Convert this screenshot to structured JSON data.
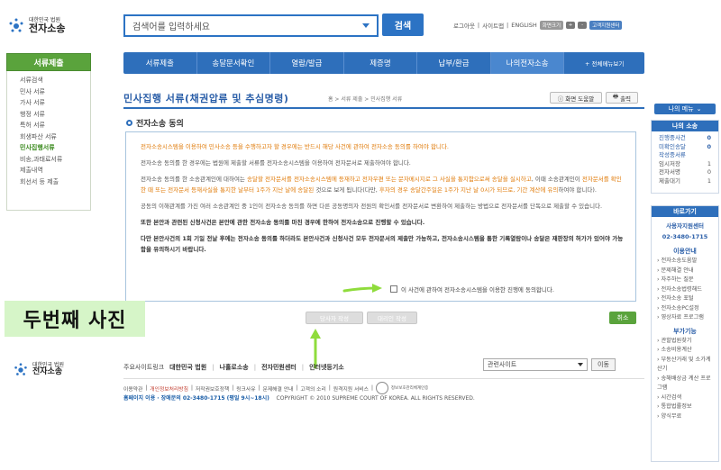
{
  "header": {
    "logo_small": "대한민국 법원",
    "logo_big": "전자소송",
    "search_placeholder": "검색어를 입력하세요",
    "search_button": "검색",
    "top_links": [
      "로그아웃",
      "|",
      "사이트맵",
      "|",
      "ENGLISH"
    ],
    "zoom_label": "화면크기",
    "zoom_plus": "+",
    "zoom_minus": "-",
    "remote_help": "고객지원센터"
  },
  "nav": {
    "items": [
      "서류제출",
      "송달문서확인",
      "열람/발급",
      "제증명",
      "납부/환급",
      "나의전자소송"
    ],
    "more": "+ 전체메뉴보기"
  },
  "left_sidebar": {
    "title": "서류제출",
    "items": [
      "서류검색",
      "민사 서류",
      "가사 서류",
      "행정 서류",
      "특허 서류",
      "회생파산 서류",
      "민사집행서류",
      "비송,과태료서류",
      "제출내역",
      "회선서 등 제출"
    ]
  },
  "main": {
    "page_title": "민사집행 서류(채권압류 및 추심명령)",
    "breadcrumb": "홈 > 서류 제출 > 민사집행 서류",
    "help_button": "화면 도움말",
    "print_button": "출력",
    "section_title": "전자소송 동의",
    "para1": "전자소송시스템을 이용하여 민사소송 등을 수행하고자 할 경우에는 반드시 해당 사건에 관하여 전자소송 동의를 하여야 합니다.",
    "para2": "전자소송 동의를 한 경우에는 법원에 제출할 서류를 전자소송시스템을 이용하여 전자문서로 제출하여야 합니다.",
    "para3_a": "전자소송 동의를 한 소송관계인에 대하여는 ",
    "para3_b": "송달할 전자문서를 전자소송시스템에 등재하고 전자우편 또는 문자메시지로 그 사실을 통지함으로써 송달을 실시하고",
    "para3_c": ", 이때 소송관계인이 ",
    "para3_d": "전자문서를 확인한 때 또는 전자문서 등재사실을 통지한 날부터 1주가 지난 날에 송달된",
    "para3_e": " 것으로 보게 됩니다(다만, ",
    "para3_f": "후자의 경우 송달간주일은 1주가 지난 날 0시가 되므로, 기간 계산에 유의",
    "para3_g": "하여야 합니다).",
    "para4": "공동의 이해관계를 가진 여러 소송관계인 중 1인이 전자소송 동의를 하면 다른 공동명의자 전원의 확인서를 전자문서로 변환하여 제출하는 방법으로 전자문서를 단독으로 제출할 수 있습니다.",
    "para5": "또한 본안과 관련된 신청사건은 본안에 관한 전자소송 동의를 마친 경우에 한하여 전자소송으로 진행할 수 있습니다.",
    "para6": "다만 본안사건의 1심 기일 전날에 소송이 종료하는 경우에 등재를 허가하는 것은 본안사건 기일 전에 그 파일을 확인하게 하여야 하므로 본안사건과 신청사건 모두 전자문서로 제출이 가능하고, 전자소송시스템을 통한 기록열람이나 송달은 재판장의 허가가 있어야 가능함을 유의하시기 바랍니다.",
    "para6_short": "다만 본안사건의 1회 기일 전날 후에는 전자소송 동의를 하더라도 본안사건과 신청사건 모두 전자문서의 제출만 가능하고, 전자소송시스템을 통한 기록열람이나 송달은 재판장의 허가가 있어야 가능함을 유의하시기 바랍니다.",
    "agree_label": "이 사건에 관하여 전자소송시스템을 이용한 진행에 동의합니다.",
    "btn_confirm": "당사자 작성",
    "btn_proxy": "대리인 작성",
    "btn_cancel": "취소"
  },
  "annotation": {
    "label": "두번째 사진",
    "arrow_color": "#8fdc3c"
  },
  "footer": {
    "logo_small": "대한민국 법원",
    "logo_big": "전자소송",
    "links": [
      "주요사이트링크",
      "대한민국 법원",
      "|",
      "나홀로소송",
      "|",
      "전자민원센터",
      "|",
      "인터넷등기소"
    ],
    "related_sites": "관련사이트",
    "go_button": "이동",
    "sub_links": [
      "이용약관",
      "|",
      "개인정보처리방침",
      "|",
      "저작권보호정책",
      "|",
      "링크사유",
      "|",
      "문제해결 안내",
      "|",
      "고객의 소리",
      "|",
      "원격지원 서비스",
      "|"
    ],
    "certification": "정보보호관리체계인증",
    "contact_home": "홈페이지 이용 · 장애문의 02-3480-1715 (평일 9시~18시)",
    "copyright": "COPYRIGHT © 2010 SUPREME COURT OF KOREA. ALL RIGHTS RESERVED."
  },
  "right_sidebar": {
    "my_menu": "나의 메뉴",
    "my_suit_title": "나의 소송",
    "counts": [
      {
        "label": "진행중사건",
        "value": "0"
      },
      {
        "label": "미확인송달",
        "value": "0"
      },
      {
        "label": "작성중서류",
        "value": ""
      },
      {
        "label": "임시저장",
        "value": "1"
      },
      {
        "label": "전자서명",
        "value": "0"
      },
      {
        "label": "제출대기",
        "value": "1"
      }
    ],
    "shortcut_title": "바로가기",
    "phone_title": "사용자지원센터",
    "phone": "02-3480-1715",
    "guide_title": "이용안내",
    "guide_links": [
      "전자소송도움말",
      "문제해결 안내",
      "자주하는 질문",
      "전자소송법령해드",
      "전자소송 포털",
      "전자소송PC설정",
      "영상자료 프로그램"
    ],
    "extra_title": "부가기능",
    "extra_links": [
      "관할법원찾기",
      "소송비용계산",
      "부동산거래 및 소가계산기",
      "송해배상금 계산 프로그램",
      "시간검색",
      "통합법률정보",
      "양식무료"
    ]
  },
  "icons": {
    "logo": "court-star-logo",
    "search_arrow": "chevron-down-icon",
    "help": "info-icon",
    "print": "printer-icon",
    "bullet": "circle-bullet-icon",
    "checkbox": "checkbox-icon",
    "arrow1": "green-arrow-right-icon",
    "arrow2": "green-arrow-up-icon"
  }
}
